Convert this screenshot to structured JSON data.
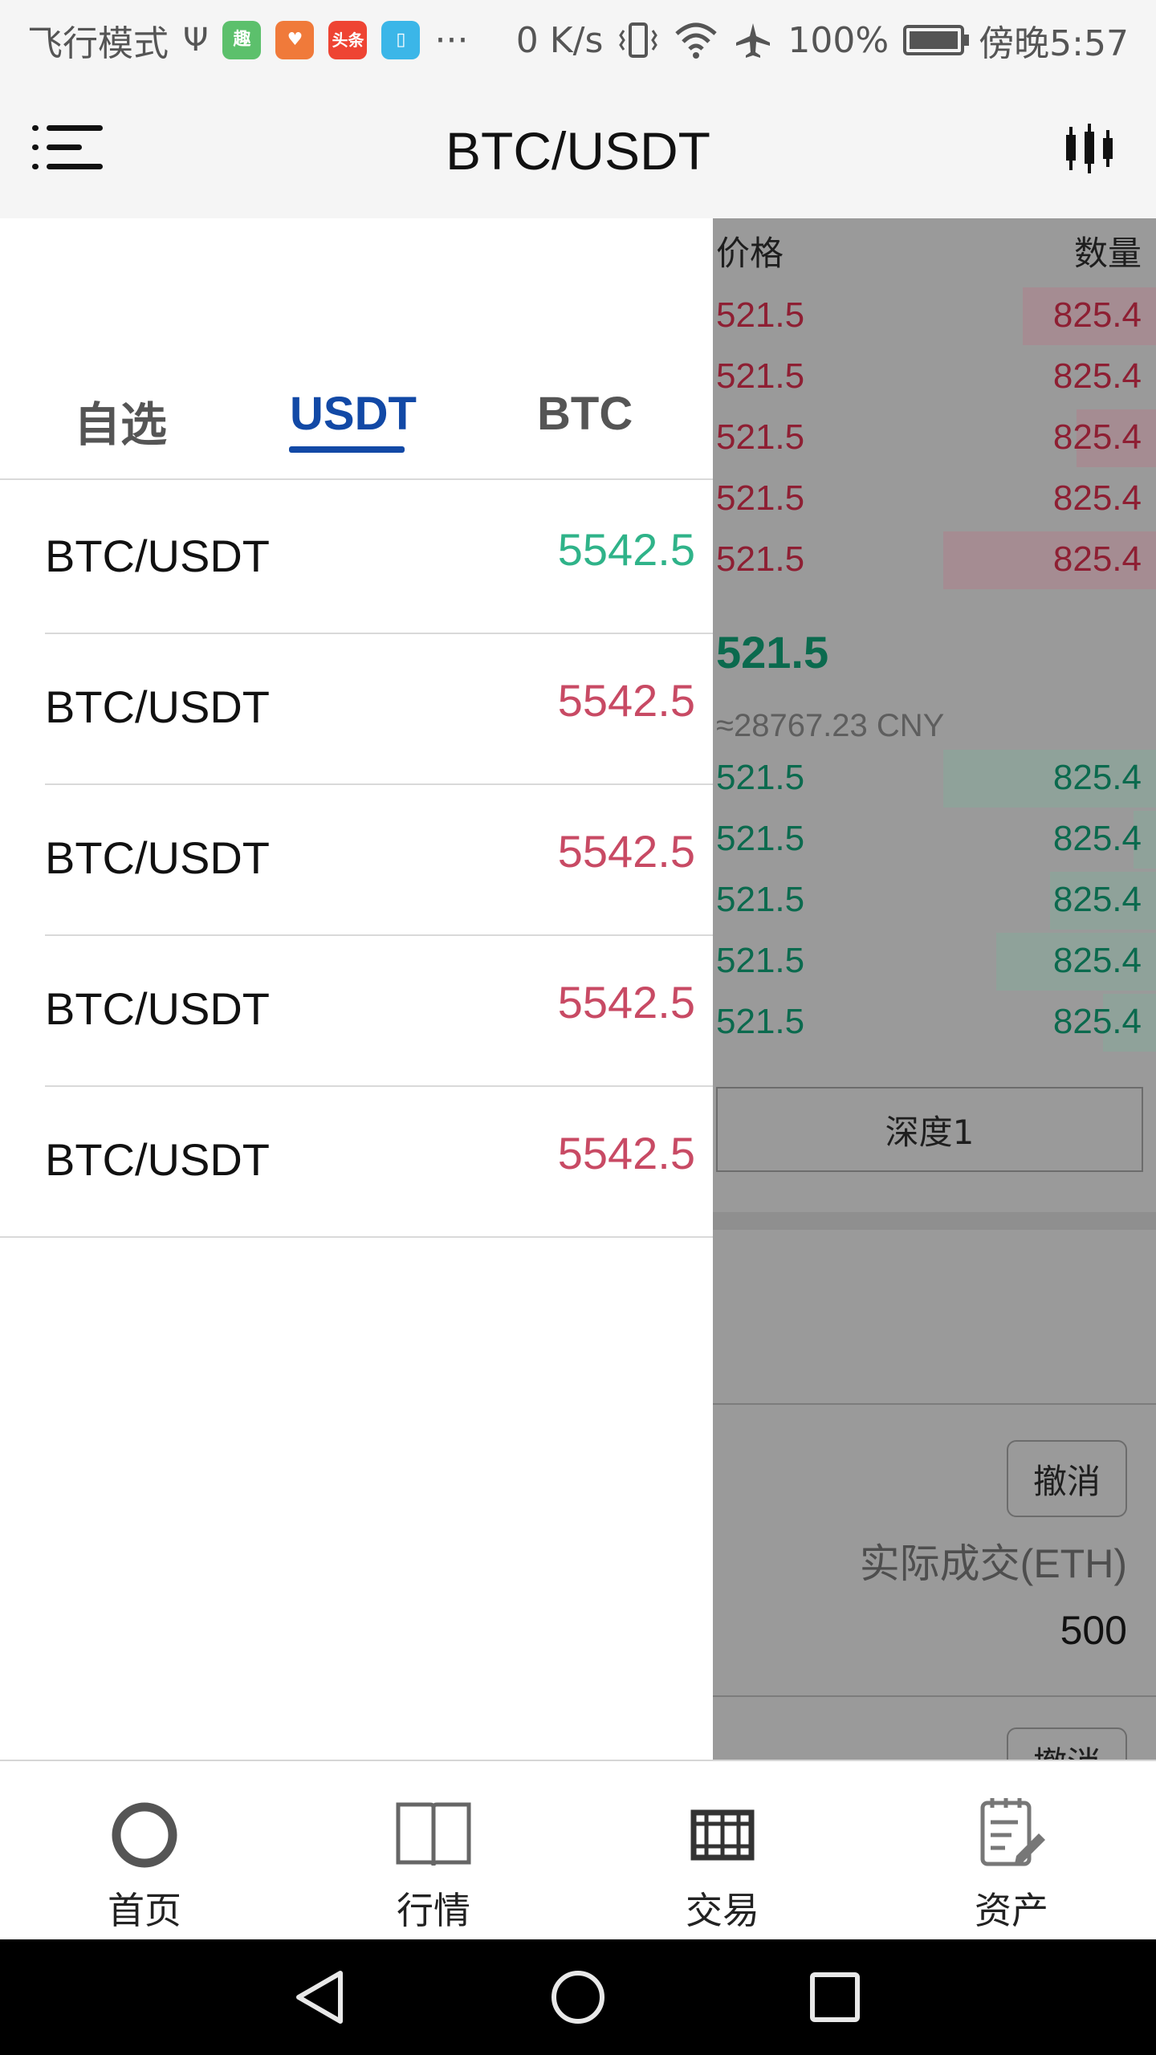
{
  "status_bar": {
    "mode": "飞行模式",
    "apps": [
      {
        "name": "qu-app-icon",
        "glyph": "趣",
        "color": "#5cc06c"
      },
      {
        "name": "heart-app-icon",
        "glyph": "♥",
        "color": "#f07a3a"
      },
      {
        "name": "toutiao-app-icon",
        "glyph": "头条",
        "color": "#ee4433"
      },
      {
        "name": "book-app-icon",
        "glyph": "▯",
        "color": "#3bb6e8"
      }
    ],
    "more": "···",
    "net_speed": "0 K/s",
    "battery": "100%",
    "time": "傍晚5:57"
  },
  "header": {
    "title": "BTC/USDT",
    "menu_icon": "menu-list-icon",
    "chart_icon": "candlestick-icon"
  },
  "drawer": {
    "tabs": [
      {
        "label": "自选",
        "active": false
      },
      {
        "label": "USDT",
        "active": true
      },
      {
        "label": "BTC",
        "active": false
      }
    ],
    "pairs": [
      {
        "name": "BTC/USDT",
        "price": "5542.5",
        "trend": "up"
      },
      {
        "name": "BTC/USDT",
        "price": "5542.5",
        "trend": "down"
      },
      {
        "name": "BTC/USDT",
        "price": "5542.5",
        "trend": "down"
      },
      {
        "name": "BTC/USDT",
        "price": "5542.5",
        "trend": "down"
      },
      {
        "name": "BTC/USDT",
        "price": "5542.5",
        "trend": "down"
      }
    ]
  },
  "orderbook": {
    "price_header": "价格",
    "qty_header": "数量",
    "asks": [
      {
        "price": "521.5",
        "qty": "825.4",
        "depth": 0.3
      },
      {
        "price": "521.5",
        "qty": "825.4",
        "depth": 0.0
      },
      {
        "price": "521.5",
        "qty": "825.4",
        "depth": 0.18
      },
      {
        "price": "521.5",
        "qty": "825.4",
        "depth": 0.0
      },
      {
        "price": "521.5",
        "qty": "825.4",
        "depth": 0.48
      }
    ],
    "last_price": "521.5",
    "cny_price": "≈28767.23 CNY",
    "bids": [
      {
        "price": "521.5",
        "qty": "825.4",
        "depth": 0.48
      },
      {
        "price": "521.5",
        "qty": "825.4",
        "depth": 0.05
      },
      {
        "price": "521.5",
        "qty": "825.4",
        "depth": 0.24
      },
      {
        "price": "521.5",
        "qty": "825.4",
        "depth": 0.36
      },
      {
        "price": "521.5",
        "qty": "825.4",
        "depth": 0.12
      }
    ],
    "depth_button": "深度1"
  },
  "orders": {
    "cancel_label": "撤消",
    "actual_label": "实际成交(ETH)",
    "actual_value": "500"
  },
  "colors": {
    "up": "#2fb389",
    "down": "#c84a64",
    "active_tab": "#1249a6"
  },
  "bottom_nav": [
    {
      "label": "首页",
      "icon": "home-ring-icon"
    },
    {
      "label": "行情",
      "icon": "open-book-icon"
    },
    {
      "label": "交易",
      "icon": "film-strip-icon"
    },
    {
      "label": "资产",
      "icon": "notepad-edit-icon"
    }
  ],
  "system_nav": {
    "back": "back-triangle-icon",
    "home": "home-circle-icon",
    "recents": "recents-square-icon"
  }
}
